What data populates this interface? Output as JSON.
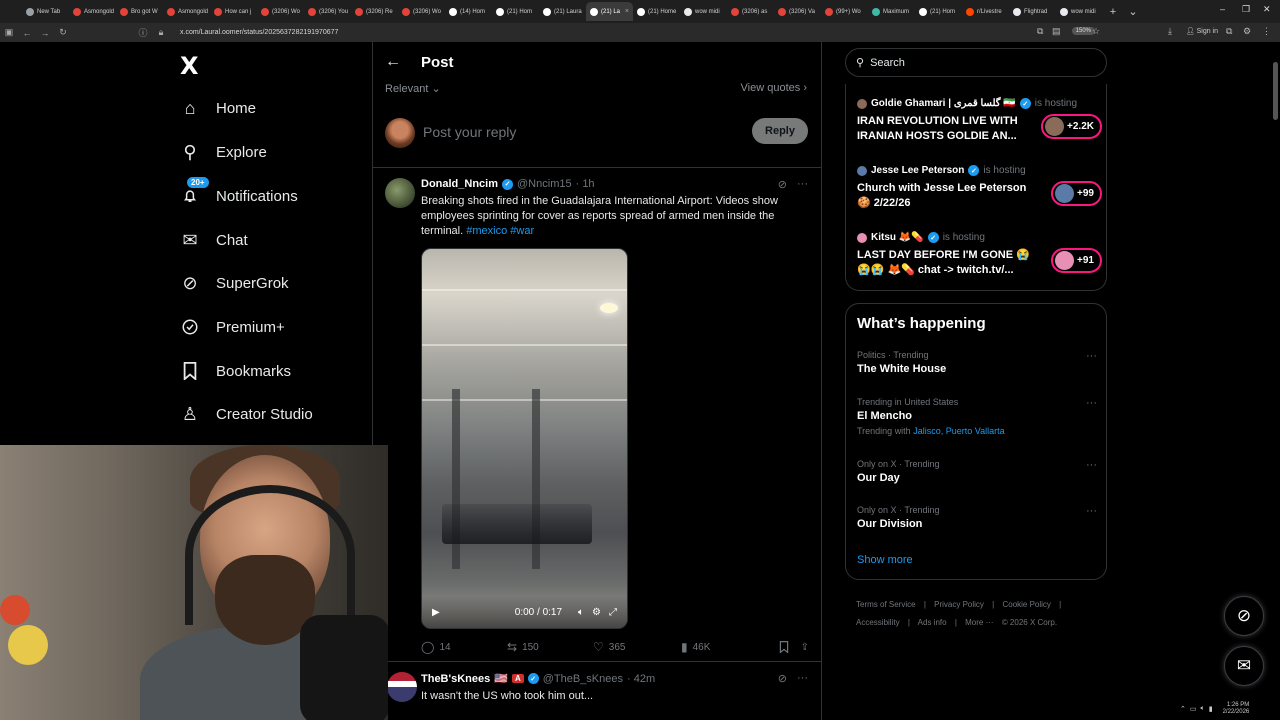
{
  "browser": {
    "tabs": [
      {
        "title": "New Tab",
        "color": "#9aa0a6",
        "active": false
      },
      {
        "title": "Asmongold",
        "color": "#e0443a",
        "active": false
      },
      {
        "title": "Bro got W",
        "color": "#e0443a",
        "active": false
      },
      {
        "title": "Asmongold",
        "color": "#e0443a",
        "active": false
      },
      {
        "title": "How can j",
        "color": "#e0443a",
        "active": false
      },
      {
        "title": "(3206) Wo",
        "color": "#e0443a",
        "active": false
      },
      {
        "title": "(3206) You",
        "color": "#e0443a",
        "active": false
      },
      {
        "title": "(3206) Re",
        "color": "#e0443a",
        "active": false
      },
      {
        "title": "(3206) Wo",
        "color": "#e0443a",
        "active": false
      },
      {
        "title": "(14) Hom",
        "color": "#ffffff",
        "active": false
      },
      {
        "title": "(21) Hom",
        "color": "#ffffff",
        "active": false
      },
      {
        "title": "(21) Laura",
        "color": "#ffffff",
        "active": false
      },
      {
        "title": "(21) La",
        "color": "#ffffff",
        "active": true
      },
      {
        "title": "(21) Home",
        "color": "#ffffff",
        "active": false
      },
      {
        "title": "wow midi",
        "color": "#e8eaed",
        "active": false
      },
      {
        "title": "(3206) as",
        "color": "#e0443a",
        "active": false
      },
      {
        "title": "(3206) Va",
        "color": "#e0443a",
        "active": false
      },
      {
        "title": "(99+) Wo",
        "color": "#e0443a",
        "active": false
      },
      {
        "title": "Maximum",
        "color": "#3fb8a5",
        "active": false
      },
      {
        "title": "(21) Hom",
        "color": "#ffffff",
        "active": false
      },
      {
        "title": "r/Livestre",
        "color": "#ff4500",
        "active": false
      },
      {
        "title": "Flightrad",
        "color": "#e8eaed",
        "active": false
      },
      {
        "title": "wow midi",
        "color": "#e8eaed",
        "active": false
      }
    ],
    "url": "x.com/Laural.oomer/status/2025637282191970677",
    "zoom": "150%",
    "sign_in": "Sign in"
  },
  "nav": {
    "logo": "X",
    "items": [
      {
        "label": "Home",
        "icon": "home-icon",
        "glyph": "⌂"
      },
      {
        "label": "Explore",
        "icon": "search-icon",
        "glyph": "⚲"
      },
      {
        "label": "Notifications",
        "icon": "bell-icon",
        "glyph": "♫"
      },
      {
        "label": "Chat",
        "icon": "mail-icon",
        "glyph": "✉"
      },
      {
        "label": "SuperGrok",
        "icon": "grok-icon",
        "glyph": "⊘"
      },
      {
        "label": "Premium+",
        "icon": "verified-icon",
        "glyph": "✪"
      },
      {
        "label": "Bookmarks",
        "icon": "bookmark-icon",
        "glyph": "▯"
      },
      {
        "label": "Creator Studio",
        "icon": "creator-icon",
        "glyph": "♙"
      }
    ],
    "notifications_badge": "20+"
  },
  "post": {
    "title": "Post",
    "sort_label": "Relevant",
    "view_quotes": "View quotes",
    "reply_placeholder": "Post your reply",
    "reply_button": "Reply"
  },
  "tweet": {
    "name": "Donald_Nncim",
    "handle": "@Nncim15",
    "time": "· 1h",
    "text": "Breaking shots fired in the  Guadalajara International Airport: Videos show employees sprinting for cover as reports spread of armed men inside the terminal.",
    "hashtags": [
      "#mexico",
      "#war"
    ],
    "video_time": "0:00 / 0:17",
    "replies": "14",
    "reposts": "150",
    "likes": "365",
    "views": "46K"
  },
  "tweet2": {
    "name": "TheB'sKnees",
    "badge": "A",
    "handle": "@TheB_sKnees",
    "time": "· 42m",
    "text": "It wasn't the US who took him out..."
  },
  "search": {
    "placeholder": "Search"
  },
  "spaces": [
    {
      "host": "Goldie Ghamari | گلسا قمری 🇮🇷",
      "status": "is hosting",
      "title": "IRAN REVOLUTION LIVE WITH IRANIAN HOSTS GOLDIE AN...",
      "listeners": "+2.2K",
      "avatar_color": "#8a6b5a"
    },
    {
      "host": "Jesse Lee Peterson",
      "status": "is hosting",
      "title": "Church with Jesse Lee Peterson 🍪 2/22/26",
      "listeners": "+99",
      "avatar_color": "#5a7aa8"
    },
    {
      "host": "Kitsu 🦊💊",
      "status": "is hosting",
      "title": "LAST DAY BEFORE I'M GONE 😭 😭😭 🦊💊 chat -> twitch.tv/...",
      "listeners": "+91",
      "avatar_color": "#e88fb5"
    }
  ],
  "happening": {
    "title": "What’s happening",
    "trends": [
      {
        "meta": "Politics · Trending",
        "name": "The White House",
        "with_label": "",
        "with_links": ""
      },
      {
        "meta": "Trending in United States",
        "name": "El Mencho",
        "with_label": "Trending with",
        "with_links": "Jalisco, Puerto Vallarta"
      },
      {
        "meta": "Only on X · Trending",
        "name": "Our Day",
        "with_label": "",
        "with_links": ""
      },
      {
        "meta": "Only on X · Trending",
        "name": "Our Division",
        "with_label": "",
        "with_links": ""
      }
    ],
    "show_more": "Show more"
  },
  "footer": [
    "Terms of Service",
    "|",
    "Privacy Policy",
    "|",
    "Cookie Policy",
    "|",
    "Accessibility",
    "|",
    "Ads info",
    "|",
    "More ···",
    "© 2026 X Corp."
  ],
  "tray": {
    "time": "1:26 PM",
    "date": "2/22/2026"
  },
  "colors": {
    "accent": "#1d9bf0",
    "live": "#f91880",
    "border": "#2f3336",
    "muted": "#71767b"
  }
}
